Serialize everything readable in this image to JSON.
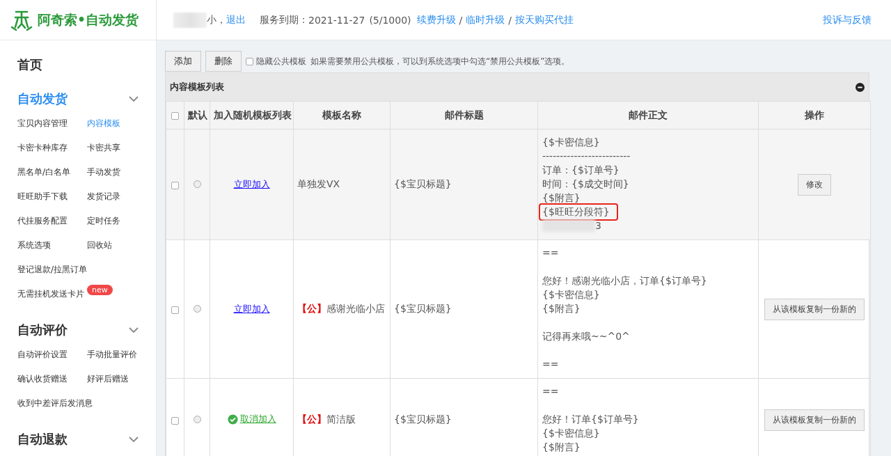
{
  "header": {
    "logo": "阿奇索•自动发货",
    "user_name": "小，",
    "logout": "退出",
    "service_label": "服务到期：",
    "expiry": "2021-11-27",
    "quota": "(5/1000)",
    "links": [
      {
        "kind": "link",
        "text": "续费升级"
      },
      {
        "kind": "separator",
        "text": "/"
      },
      {
        "kind": "link",
        "text": "临时升级"
      },
      {
        "kind": "separator",
        "text": "/"
      },
      {
        "kind": "link",
        "text": "按天购买代挂"
      }
    ],
    "feedback": "投诉与反馈"
  },
  "sidebar": {
    "sections": [
      {
        "title": "首页",
        "selected": false,
        "collapsible": false
      },
      {
        "title": "自动发货",
        "selected": true,
        "collapsible": true,
        "items": [
          {
            "label": "宝贝内容管理",
            "selected": false
          },
          {
            "label": "内容模板",
            "selected": true
          },
          {
            "label": "卡密卡种库存",
            "selected": false
          },
          {
            "label": "卡密共享",
            "selected": false
          },
          {
            "label": "黑名单/白名单",
            "selected": false
          },
          {
            "label": "手动发货",
            "selected": false
          },
          {
            "label": "旺旺助手下载",
            "selected": false
          },
          {
            "label": "发货记录",
            "selected": false
          },
          {
            "label": "代挂服务配置",
            "selected": false
          },
          {
            "label": "定时任务",
            "selected": false
          },
          {
            "label": "系统选项",
            "selected": false
          },
          {
            "label": "回收站",
            "selected": false
          },
          {
            "label": "登记退款/拉黑订单",
            "selected": false,
            "wide": true
          },
          {
            "label": "无需挂机发送卡片",
            "selected": false,
            "wide": true,
            "badge": "new"
          }
        ]
      },
      {
        "title": "自动评价",
        "selected": false,
        "collapsible": true,
        "items": [
          {
            "label": "自动评价设置",
            "selected": false
          },
          {
            "label": "手动批量评价",
            "selected": false
          },
          {
            "label": "确认收货赠送",
            "selected": false
          },
          {
            "label": "好评后赠送",
            "selected": false
          },
          {
            "label": "收到中差评后发消息",
            "selected": false,
            "wide": true
          }
        ]
      },
      {
        "title": "自动退款",
        "selected": false,
        "collapsible": true
      }
    ]
  },
  "toolbar": {
    "buttons": [
      "添加",
      "删除"
    ],
    "checkbox": {
      "label": "隐藏公共模板",
      "checked": false
    },
    "hint": "如果需要禁用公共模板，可以到系统选项中勾选“禁用公共模板”选项。"
  },
  "panel": {
    "title": "内容模板列表",
    "table": {
      "select_all_checked": false,
      "columns": [
        "默认",
        "加入随机模板列表",
        "模板名称",
        "邮件标题",
        "邮件正文",
        "操作"
      ],
      "rows": [
        {
          "hovered": true,
          "checked": false,
          "default": {
            "selected": false
          },
          "join": {
            "kind": "add",
            "label": "立即加入"
          },
          "name": "单独发VX",
          "subject": "{$宝贝标题}",
          "body": [
            {
              "text": "{$卡密信息}"
            },
            {
              "text": "-------------------------"
            },
            {
              "text": "订单：{$订单号}"
            },
            {
              "text": "时间：{$成交时间}"
            },
            {
              "text": "{$附言}"
            },
            {
              "text": "{$旺旺分段符}",
              "highlighted": true
            },
            {
              "text": "3",
              "blurred": true
            }
          ],
          "action": "修改"
        },
        {
          "hovered": false,
          "checked": false,
          "default": {
            "selected": false
          },
          "join": {
            "kind": "add",
            "label": "立即加入"
          },
          "public_tag": "【公】",
          "name": "感谢光临小店",
          "subject": "{$宝贝标题}",
          "body": [
            {
              "text": "=="
            },
            {
              "text": "您好！感谢光临小店，订单{$订单号}",
              "gap_before": true
            },
            {
              "text": "{$卡密信息}"
            },
            {
              "text": "{$附言}"
            },
            {
              "text": "记得再来哦~~^0^",
              "gap_before": true
            },
            {
              "text": "==",
              "gap_before": true
            }
          ],
          "action": "从该模板复制一份新的"
        },
        {
          "hovered": false,
          "checked": false,
          "default": {
            "selected": false
          },
          "join": {
            "kind": "remove",
            "label": "取消加入"
          },
          "public_tag": "【公】",
          "name": "简洁版",
          "subject": "{$宝贝标题}",
          "body": [
            {
              "text": "=="
            },
            {
              "text": "您好！订单{$订单号}",
              "gap_before": true
            },
            {
              "text": "{$卡密信息}"
            },
            {
              "text": "{$附言}"
            }
          ],
          "action": "从该模板复制一份新的"
        }
      ]
    }
  }
}
